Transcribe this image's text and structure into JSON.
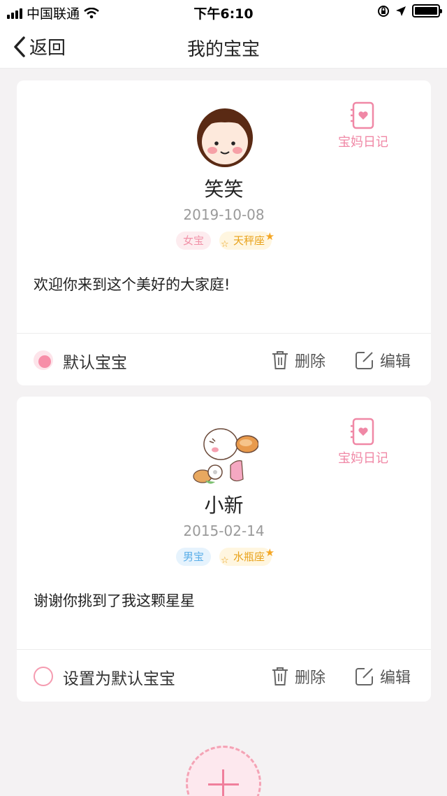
{
  "status_bar": {
    "carrier": "中国联通",
    "time": "下午6:10"
  },
  "nav": {
    "back_label": "返回",
    "title": "我的宝宝"
  },
  "babies": [
    {
      "name": "笑笑",
      "birthday": "2019-10-08",
      "gender_tag": "女宝",
      "zodiac_tag": "天秤座",
      "message": "欢迎你来到这个美好的大家庭!",
      "diary_label": "宝妈日记",
      "default_label": "默认宝宝",
      "delete_label": "删除",
      "edit_label": "编辑",
      "is_default": true
    },
    {
      "name": "小新",
      "birthday": "2015-02-14",
      "gender_tag": "男宝",
      "zodiac_tag": "水瓶座",
      "message": "谢谢你挑到了我这颗星星",
      "diary_label": "宝妈日记",
      "default_label": "设置为默认宝宝",
      "delete_label": "删除",
      "edit_label": "编辑",
      "is_default": false
    }
  ],
  "colors": {
    "accent_pink": "#f78ea8",
    "girl_tag": "#f192a8",
    "boy_tag": "#5aaee8",
    "zodiac_tag": "#e8a21a"
  },
  "icons": [
    "back-chevron-icon",
    "diary-heart-icon",
    "trash-icon",
    "edit-icon",
    "add-icon"
  ]
}
